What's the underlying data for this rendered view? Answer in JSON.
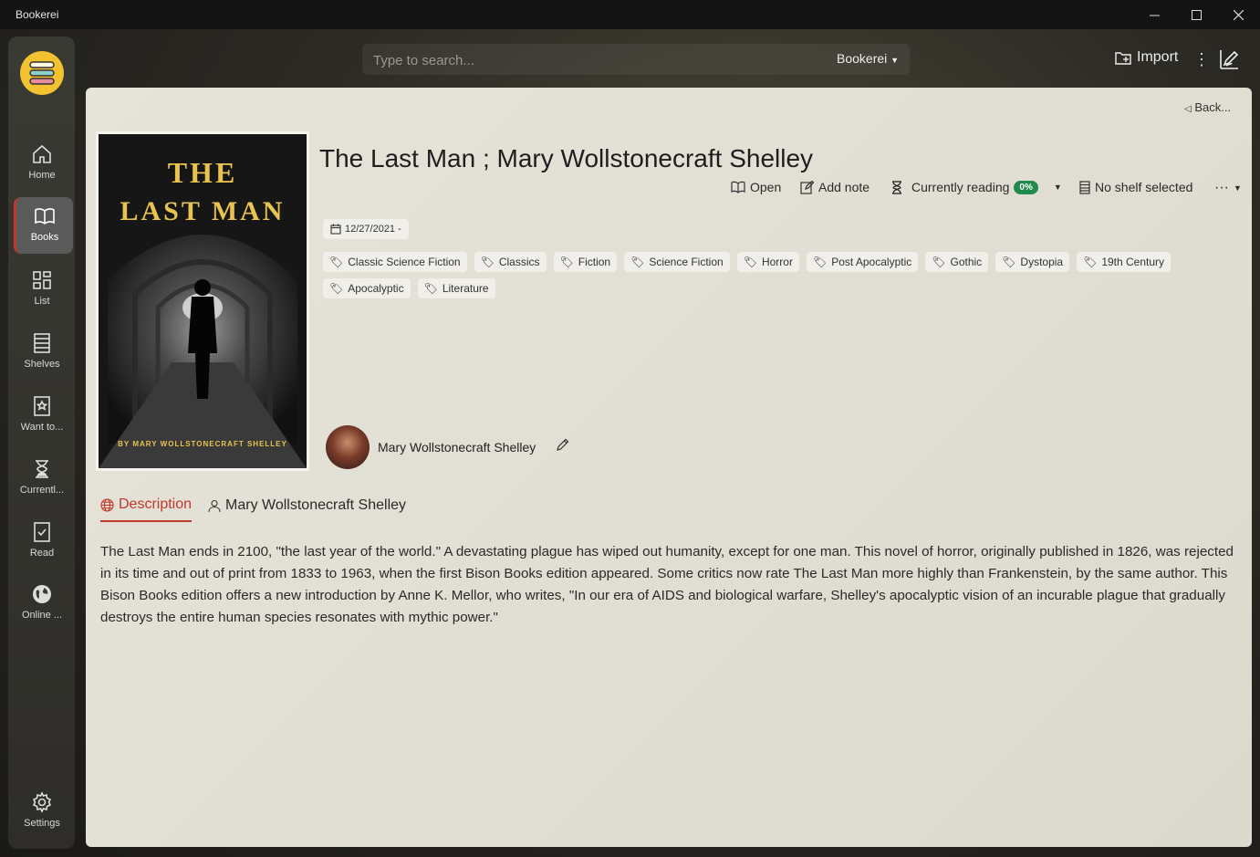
{
  "window": {
    "title": "Bookerei"
  },
  "sidebar": {
    "items": [
      {
        "label": "Home",
        "icon": "home-icon"
      },
      {
        "label": "Books",
        "icon": "book-open-icon",
        "active": true
      },
      {
        "label": "List",
        "icon": "grid-icon"
      },
      {
        "label": "Shelves",
        "icon": "shelves-icon"
      },
      {
        "label": "Want to...",
        "icon": "bookmark-star-icon"
      },
      {
        "label": "Currentl...",
        "icon": "hourglass-icon"
      },
      {
        "label": "Read",
        "icon": "bookmark-check-icon"
      },
      {
        "label": "Online ...",
        "icon": "globe-icon"
      }
    ],
    "settings_label": "Settings"
  },
  "header": {
    "search_placeholder": "Type to search...",
    "library_selector": "Bookerei",
    "import_label": "Import"
  },
  "book": {
    "back_label": "Back...",
    "title": "The Last Man ; Mary Wollstonecraft Shelley",
    "cover": {
      "title_line1": "THE",
      "title_line2": "LAST MAN",
      "byline": "BY MARY WOLLSTONECRAFT SHELLEY"
    },
    "actions": {
      "open": "Open",
      "add_note": "Add note",
      "reading_status": "Currently reading",
      "progress": "0%",
      "shelf": "No shelf selected"
    },
    "date": "12/27/2021 -",
    "tags": [
      "Classic Science Fiction",
      "Classics",
      "Fiction",
      "Science Fiction",
      "Horror",
      "Post Apocalyptic",
      "Gothic",
      "Dystopia",
      "19th Century",
      "Apocalyptic",
      "Literature"
    ],
    "author": "Mary Wollstonecraft Shelley",
    "tabs": {
      "description": "Description",
      "author": "Mary Wollstonecraft Shelley"
    },
    "description": "The Last Man ends in 2100, \"the last year of the world.\" A devastating plague has wiped out humanity, except for one man. This novel of horror, originally published in 1826, was rejected in its time and out of print from 1833 to 1963, when the first Bison Books edition appeared. Some critics now rate The Last Man more highly than Frankenstein, by the same author. This Bison Books edition offers a new introduction by Anne K. Mellor, who writes, \"In our era of AIDS and biological warfare, Shelley's apocalyptic vision of an incurable plague that gradually destroys the entire human species resonates with mythic power.\""
  },
  "colors": {
    "accent": "#c0392b",
    "badge": "#1f8a4c",
    "logo": "#f2c230"
  }
}
